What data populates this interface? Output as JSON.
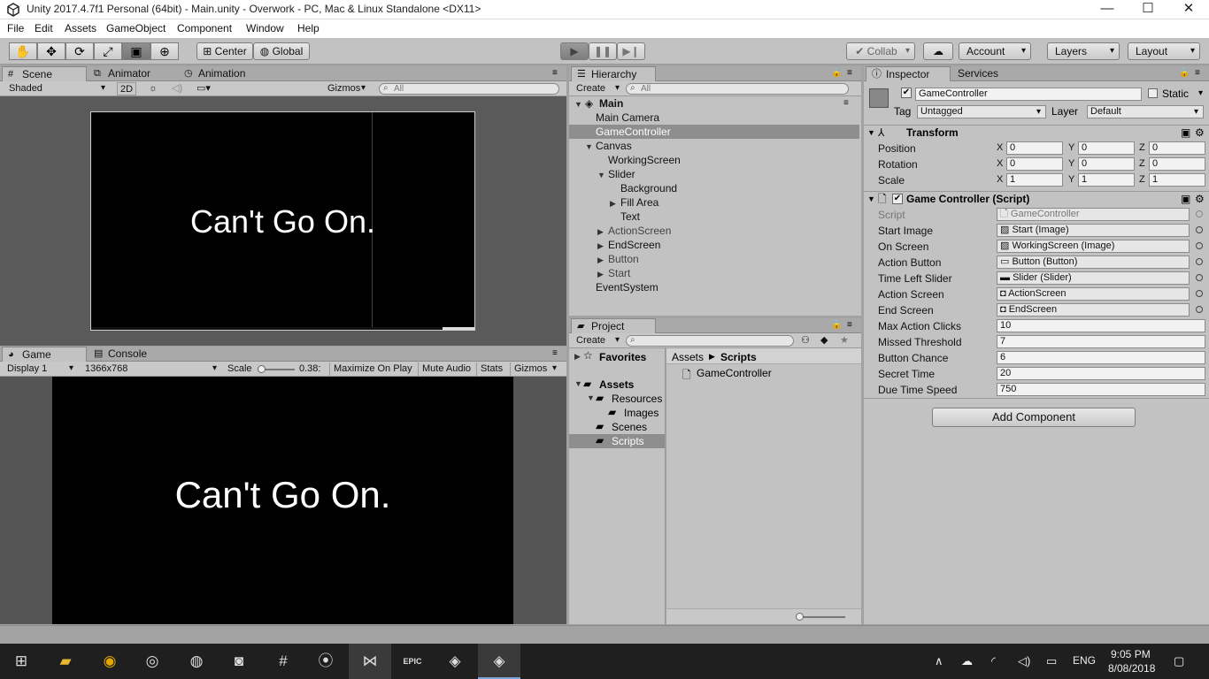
{
  "window": {
    "title": "Unity 2017.4.7f1 Personal (64bit) - Main.unity - Overwork - PC, Mac & Linux Standalone <DX11>",
    "minimize": "—",
    "maximize": "☐",
    "close": "✕"
  },
  "menu": [
    "File",
    "Edit",
    "Assets",
    "GameObject",
    "Component",
    "Window",
    "Help"
  ],
  "toolbar": {
    "center": "Center",
    "global": "Global",
    "collab": "Collab",
    "account": "Account",
    "layers": "Layers",
    "layout": "Layout"
  },
  "scene": {
    "tab": "Scene",
    "animator_tab": "Animator",
    "animation_tab": "Animation",
    "shading": "Shaded",
    "mode_2d": "2D",
    "gizmos": "Gizmos",
    "search_placeholder": "All",
    "text": "Can't Go On."
  },
  "game": {
    "tab": "Game",
    "console_tab": "Console",
    "display": "Display 1",
    "resolution": "1366x768",
    "scale_label": "Scale",
    "scale_value": "0.38:",
    "maximize": "Maximize On Play",
    "mute": "Mute Audio",
    "stats": "Stats",
    "gizmos": "Gizmos",
    "text": "Can't Go On."
  },
  "hierarchy": {
    "tab": "Hierarchy",
    "create": "Create",
    "search_placeholder": "All",
    "scene": "Main",
    "items": [
      {
        "label": "Main Camera"
      },
      {
        "label": "GameController"
      },
      {
        "label": "Canvas"
      },
      {
        "label": "WorkingScreen"
      },
      {
        "label": "Slider"
      },
      {
        "label": "Background"
      },
      {
        "label": "Fill Area"
      },
      {
        "label": "Text"
      },
      {
        "label": "ActionScreen"
      },
      {
        "label": "EndScreen"
      },
      {
        "label": "Button"
      },
      {
        "label": "Start"
      },
      {
        "label": "EventSystem"
      }
    ]
  },
  "project": {
    "tab": "Project",
    "create": "Create",
    "favorites": "Favorites",
    "assets": "Assets",
    "folders": [
      "Resources",
      "Images",
      "Scenes",
      "Scripts"
    ],
    "breadcrumb": [
      "Assets",
      "Scripts"
    ],
    "files": [
      "GameController"
    ]
  },
  "inspector": {
    "tab": "Inspector",
    "services_tab": "Services",
    "object_name": "GameController",
    "static_label": "Static",
    "tag_label": "Tag",
    "tag_value": "Untagged",
    "layer_label": "Layer",
    "layer_value": "Default",
    "transform": {
      "title": "Transform",
      "rows": [
        {
          "label": "Position",
          "x": "0",
          "y": "0",
          "z": "0"
        },
        {
          "label": "Rotation",
          "x": "0",
          "y": "0",
          "z": "0"
        },
        {
          "label": "Scale",
          "x": "1",
          "y": "1",
          "z": "1"
        }
      ]
    },
    "script": {
      "title": "Game Controller (Script)",
      "fields": [
        {
          "label": "Script",
          "value": "GameController"
        },
        {
          "label": "Start Image",
          "value": "Start (Image)"
        },
        {
          "label": "On Screen",
          "value": "WorkingScreen (Image)"
        },
        {
          "label": "Action Button",
          "value": "Button (Button)"
        },
        {
          "label": "Time Left Slider",
          "value": "Slider (Slider)"
        },
        {
          "label": "Action Screen",
          "value": "ActionScreen"
        },
        {
          "label": "End Screen",
          "value": "EndScreen"
        },
        {
          "label": "Max Action Clicks",
          "value": "10"
        },
        {
          "label": "Missed Threshold",
          "value": "7"
        },
        {
          "label": "Button Chance",
          "value": "6"
        },
        {
          "label": "Secret Time",
          "value": "20"
        },
        {
          "label": "Due Time Speed",
          "value": "750"
        }
      ]
    },
    "add_component": "Add Component"
  },
  "taskbar": {
    "lang": "ENG",
    "time": "9:05 PM",
    "date": "8/08/2018"
  }
}
